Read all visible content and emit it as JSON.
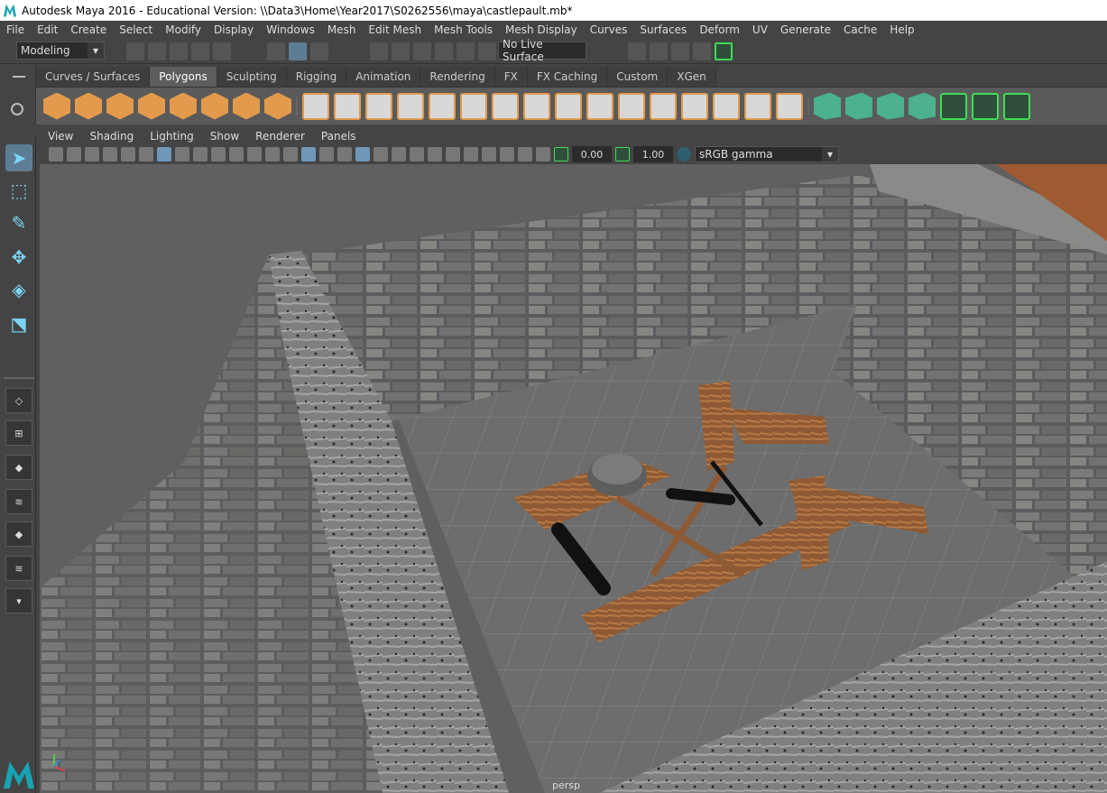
{
  "window": {
    "title": "Autodesk Maya 2016 - Educational Version: \\\\Data3\\Home\\Year2017\\S0262556\\maya\\castlepault.mb*"
  },
  "menubar": [
    "File",
    "Edit",
    "Create",
    "Select",
    "Modify",
    "Display",
    "Windows",
    "Mesh",
    "Edit Mesh",
    "Mesh Tools",
    "Mesh Display",
    "Curves",
    "Surfaces",
    "Deform",
    "UV",
    "Generate",
    "Cache",
    "Help"
  ],
  "status": {
    "mode": "Modeling",
    "live_surface": "No Live Surface"
  },
  "shelf_tabs": [
    "Curves / Surfaces",
    "Polygons",
    "Sculpting",
    "Rigging",
    "Animation",
    "Rendering",
    "FX",
    "FX Caching",
    "Custom",
    "XGen"
  ],
  "active_shelf_tab": "Polygons",
  "panel_menu": [
    "View",
    "Shading",
    "Lighting",
    "Show",
    "Renderer",
    "Panels"
  ],
  "panel_toolbar": {
    "exposure": "0.00",
    "gamma": "1.00",
    "color_space": "sRGB gamma"
  },
  "viewport": {
    "camera": "persp"
  },
  "colors": {
    "accent": "#5d7d95",
    "shelf_orange": "#e39a4c",
    "shelf_green": "#4bb18f",
    "highlight_green": "#3fdc54"
  }
}
